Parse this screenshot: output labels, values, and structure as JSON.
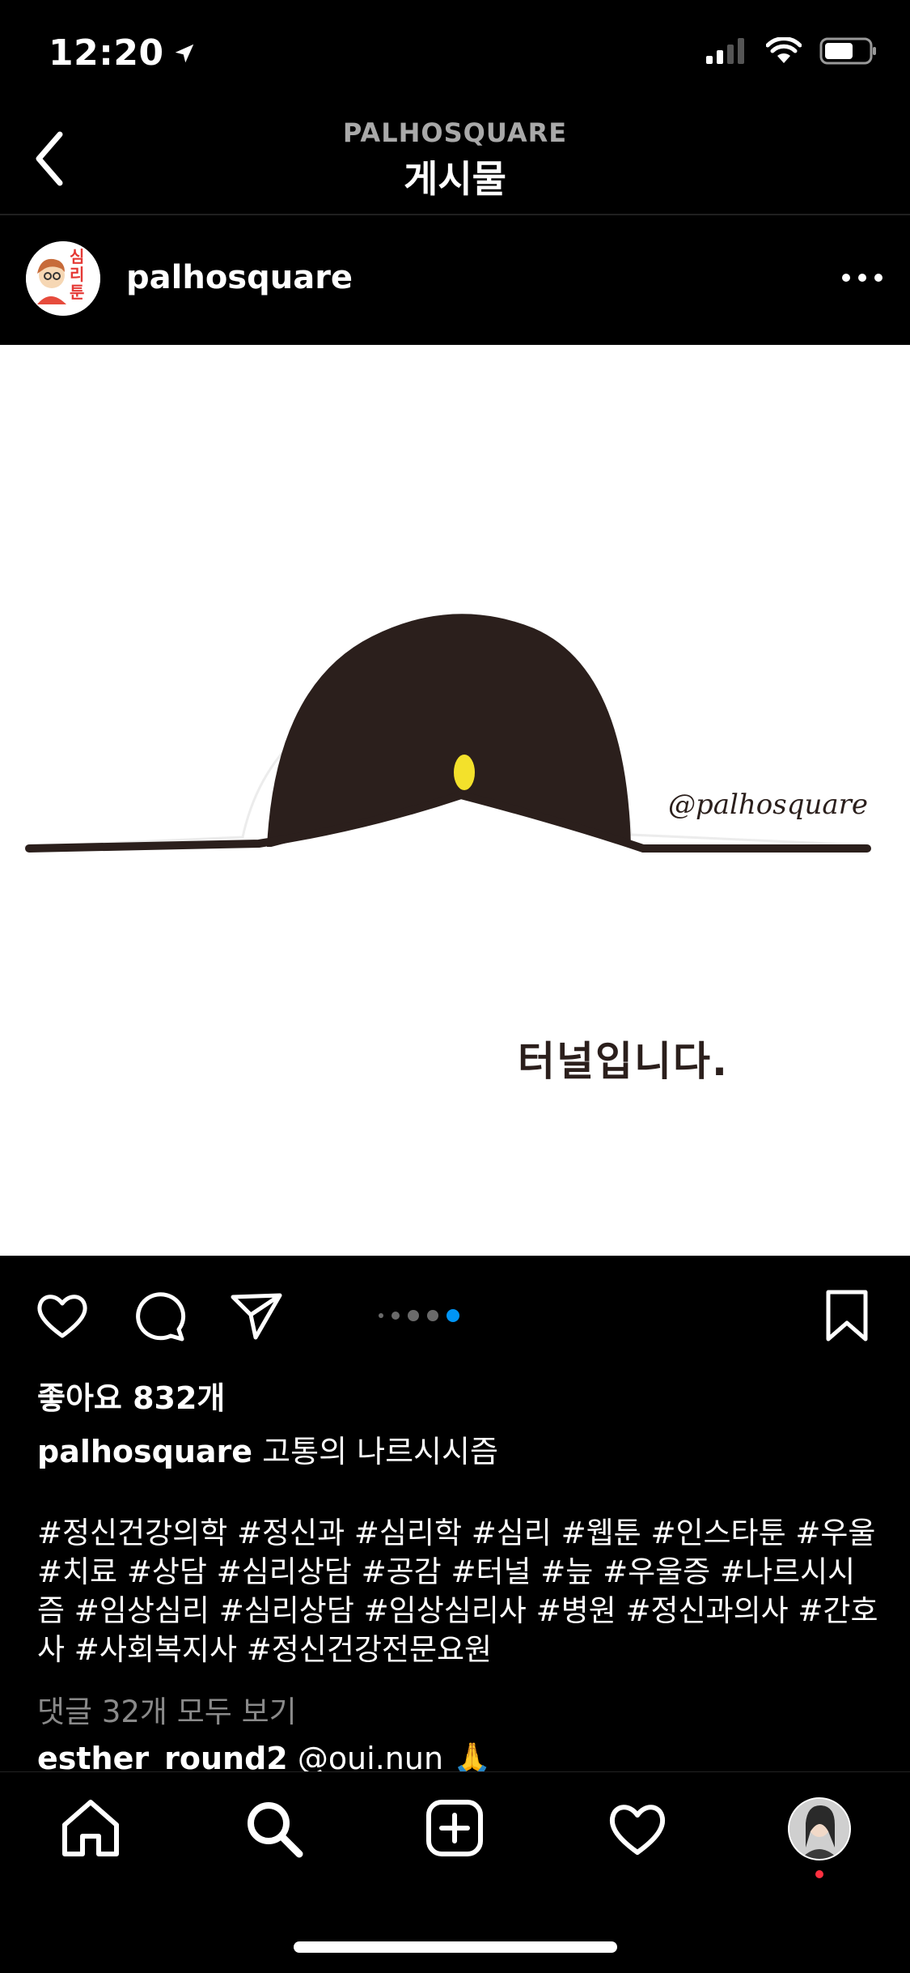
{
  "status": {
    "time": "12:20"
  },
  "header": {
    "account": "PALHOSQUARE",
    "title": "게시물"
  },
  "post": {
    "username": "palhosquare",
    "avatar_text": "심리툰",
    "image_watermark": "@palhosquare",
    "image_text": "터널입니다.",
    "carousel": {
      "count": 5,
      "active_index": 4
    },
    "likes": "좋아요 832개",
    "caption_user": "palhosquare",
    "caption_text": "고통의 나르시시즘",
    "hashtags": "#정신건강의학 #정신과 #심리학 #심리 #웹툰 #인스타툰 #우울 #치료 #상담 #심리상담 #공감 #터널 #늪 #우울증 #나르시시즘 #임상심리 #심리상담 #임상심리사 #병원 #정신과의사 #간호사 #사회복지사 #정신건강전문요원",
    "view_comments": "댓글 32개 모두 보기",
    "comment_preview_user": "esther_round2",
    "comment_preview_text": "@oui.nun 🙏"
  },
  "icons": {
    "back": "chevron-left-icon",
    "more": "more-horizontal-icon",
    "like": "heart-icon",
    "comment": "comment-icon",
    "share": "send-icon",
    "save": "bookmark-icon",
    "nav": [
      "home-icon",
      "search-icon",
      "add-post-icon",
      "activity-icon",
      "profile-icon"
    ]
  },
  "colors": {
    "background": "#000000",
    "accent": "#0095f6",
    "tunnel": "#2b1f1c",
    "light": "#f3e12b"
  }
}
